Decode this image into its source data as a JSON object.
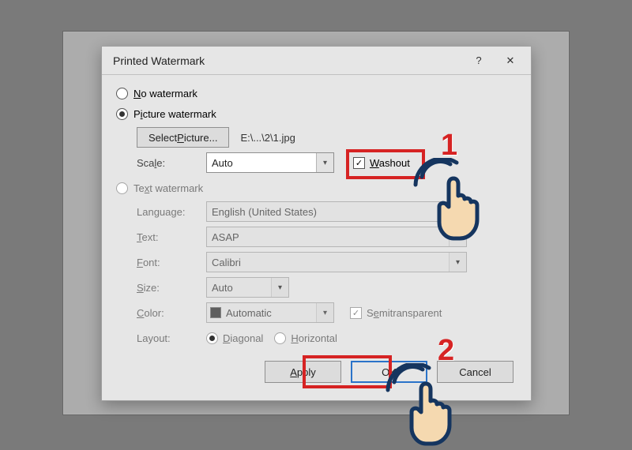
{
  "dialog": {
    "title": "Printed Watermark",
    "help_symbol": "?",
    "close_symbol": "✕",
    "options": {
      "no_watermark": "No watermark",
      "picture_watermark": "Picture watermark",
      "text_watermark": "Text watermark"
    },
    "picture": {
      "select_button": "Select Picture...",
      "path": "E:\\...\\2\\1.jpg",
      "scale_label": "Scale:",
      "scale_value": "Auto",
      "washout_label": "Washout"
    },
    "text": {
      "language_label": "Language:",
      "language_value": "English (United States)",
      "text_label": "Text:",
      "text_value": "ASAP",
      "font_label": "Font:",
      "font_value": "Calibri",
      "size_label": "Size:",
      "size_value": "Auto",
      "color_label": "Color:",
      "color_value": "Automatic",
      "semitransparent_label": "Semitransparent",
      "layout_label": "Layout:",
      "layout_diagonal": "Diagonal",
      "layout_horizontal": "Horizontal"
    },
    "buttons": {
      "apply": "Apply",
      "ok": "OK",
      "cancel": "Cancel"
    }
  },
  "annotations": {
    "step1": "1",
    "step2": "2"
  }
}
